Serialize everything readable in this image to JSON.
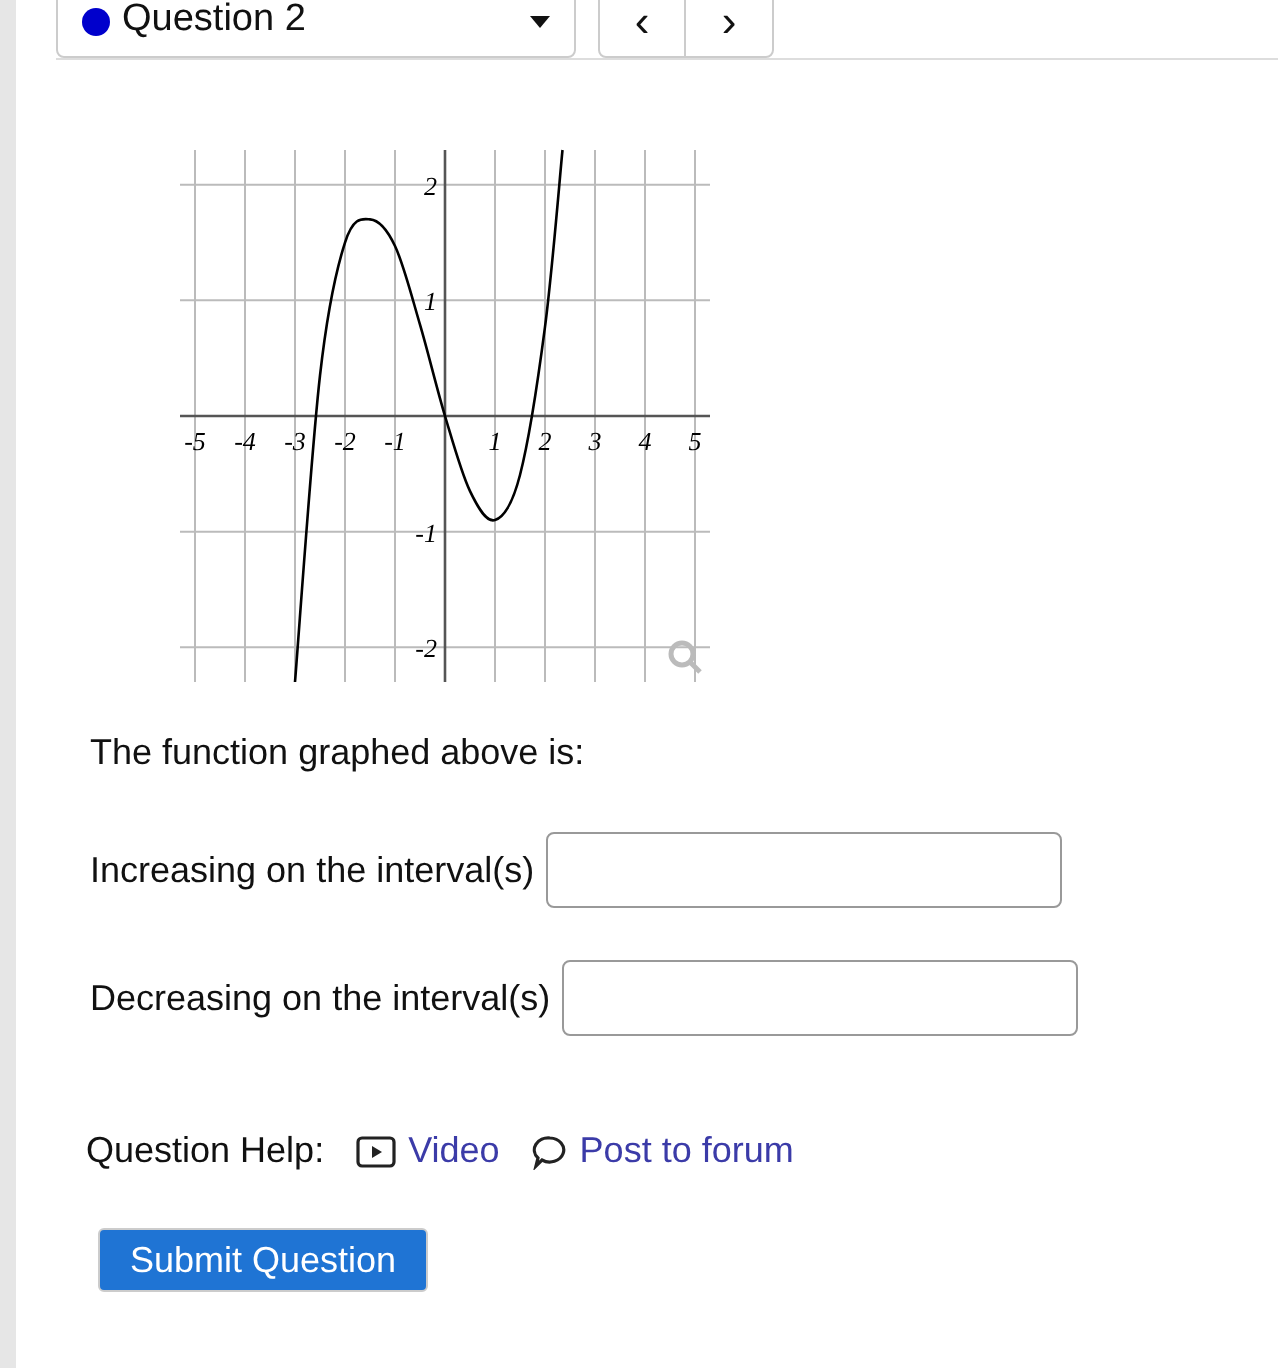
{
  "question_select": {
    "label": "Question 2",
    "color": "#0000cc"
  },
  "nav_buttons": [
    "‹",
    "›"
  ],
  "graph": {
    "chart_data": {
      "type": "line",
      "grid": true,
      "xlim": [
        -5.3,
        5.3
      ],
      "ylim": [
        -2.3,
        2.3
      ],
      "xticks": [
        {
          "value": -5,
          "label": "-5"
        },
        {
          "value": -4,
          "label": "-4"
        },
        {
          "value": -3,
          "label": "-3"
        },
        {
          "value": -2,
          "label": "-2"
        },
        {
          "value": -1,
          "label": "-1"
        },
        {
          "value": 1,
          "label": "1"
        },
        {
          "value": 2,
          "label": "2"
        },
        {
          "value": 3,
          "label": "3"
        },
        {
          "value": 4,
          "label": "4"
        },
        {
          "value": 5,
          "label": "5"
        }
      ],
      "yticks": [
        {
          "value": -2,
          "label": "-2"
        },
        {
          "value": -1,
          "label": "-1"
        },
        {
          "value": 1,
          "label": "1"
        },
        {
          "value": 2,
          "label": "2"
        }
      ],
      "x": [
        -3,
        -2.5,
        -2,
        -1.5,
        -1,
        -0.5,
        0,
        0.5,
        1,
        1.5,
        2,
        2.35
      ],
      "series": [
        {
          "color": "#000000",
          "values": [
            -2.3,
            0.35,
            1.5,
            1.7,
            1.47,
            0.79,
            0,
            -0.65,
            -0.9,
            -0.51,
            0.77,
            2.3
          ]
        }
      ]
    }
  },
  "prompt": "The function graphed above is:",
  "fields": [
    {
      "label": "Increasing on the interval(s)"
    },
    {
      "label": "Decreasing on the interval(s)"
    }
  ],
  "help": {
    "label": "Question Help:",
    "links": [
      {
        "kind": "video",
        "label": "Video"
      },
      {
        "kind": "forum",
        "label": "Post to forum"
      }
    ]
  },
  "submit": "Submit Question"
}
